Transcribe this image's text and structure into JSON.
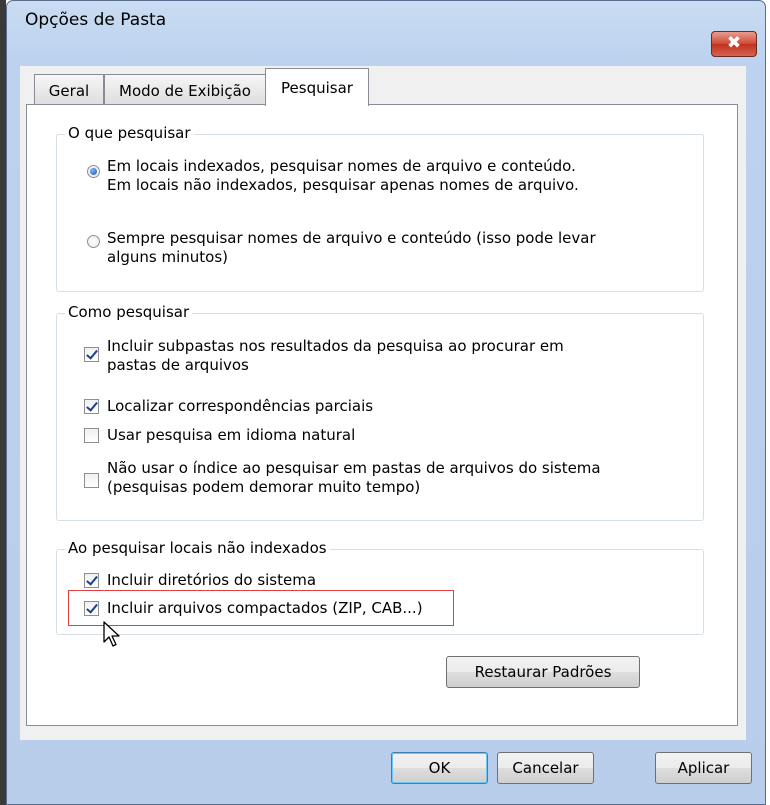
{
  "window": {
    "title": "Opções de Pasta",
    "close_glyph": "✖"
  },
  "tabs": [
    {
      "label": "Geral",
      "active": false
    },
    {
      "label": "Modo de Exibição",
      "active": false
    },
    {
      "label": "Pesquisar",
      "active": true
    }
  ],
  "group_what": {
    "legend": "O que pesquisar",
    "options": [
      {
        "line1": "Em locais indexados, pesquisar nomes de arquivo e conteúdo.",
        "line2": "Em locais não indexados, pesquisar apenas nomes de arquivo.",
        "checked": true
      },
      {
        "line1": "Sempre pesquisar nomes de arquivo e conteúdo (isso pode levar",
        "line2": "alguns minutos)",
        "checked": false
      }
    ]
  },
  "group_how": {
    "legend": "Como pesquisar",
    "options": [
      {
        "line1": "Incluir subpastas nos resultados da pesquisa ao procurar em",
        "line2": "pastas de arquivos",
        "checked": true
      },
      {
        "line1": "Localizar correspondências parciais",
        "checked": true
      },
      {
        "line1": "Usar pesquisa em idioma natural",
        "checked": false
      },
      {
        "line1": "Não usar o índice ao pesquisar em pastas de arquivos do sistema",
        "line2": "(pesquisas podem demorar muito tempo)",
        "checked": false
      }
    ]
  },
  "group_nonindexed": {
    "legend": "Ao pesquisar locais não indexados",
    "options": [
      {
        "line1": "Incluir diretórios do sistema",
        "checked": true
      },
      {
        "line1": "Incluir arquivos compactados (ZIP, CAB...)",
        "checked": true
      }
    ]
  },
  "buttons": {
    "restore": "Restaurar Padrões",
    "ok": "OK",
    "cancel": "Cancelar",
    "apply": "Aplicar"
  },
  "colors": {
    "highlight_box": "#e04040",
    "close_button": "#c0321f",
    "frame": "#bcd2ee"
  },
  "icons": {
    "cursor": "mouse-pointer-icon",
    "close": "close-icon"
  }
}
